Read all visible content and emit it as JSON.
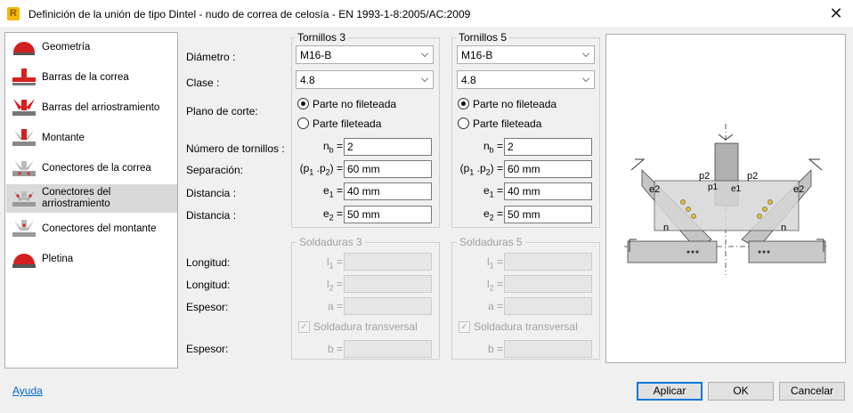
{
  "title": "Definición de la unión de tipo Dintel - nudo de correa de celosía - EN 1993-1-8:2005/AC:2009",
  "sidebar": {
    "items": [
      {
        "label": "Geometría",
        "icon": "geometry-icon"
      },
      {
        "label": "Barras de la correa",
        "icon": "chord-bars-icon"
      },
      {
        "label": "Barras del arriostramiento",
        "icon": "bracing-bars-icon"
      },
      {
        "label": "Montante",
        "icon": "post-icon"
      },
      {
        "label": "Conectores de la correa",
        "icon": "chord-connectors-icon"
      },
      {
        "label": "Conectores del arriostramiento",
        "icon": "bracing-connectors-icon"
      },
      {
        "label": "Conectores del montante",
        "icon": "post-connectors-icon"
      },
      {
        "label": "Pletina",
        "icon": "plate-icon"
      }
    ],
    "selected_index": 5
  },
  "labels": {
    "diametro": "Diámetro :",
    "clase": "Clase :",
    "plano": "Plano de corte:",
    "numero": "Número de tornillos :",
    "separacion": "Separación:",
    "distancia1": "Distancia :",
    "distancia2": "Distancia :",
    "longitud1": "Longitud:",
    "longitud2": "Longitud:",
    "espesor1": "Espesor:",
    "espesor2": "Espesor:"
  },
  "bolts3": {
    "title": "Tornillos 3",
    "diameter": "M16-B",
    "class": "4.8",
    "plane_option1": "Parte no fileteada",
    "plane_option2": "Parte fileteada",
    "plane_selected": "Parte no fileteada",
    "nb": "2",
    "p": "60 mm",
    "e1": "40 mm",
    "e2": "50 mm"
  },
  "bolts5": {
    "title": "Tornillos 5",
    "diameter": "M16-B",
    "class": "4.8",
    "plane_option1": "Parte no fileteada",
    "plane_option2": "Parte fileteada",
    "plane_selected": "Parte no fileteada",
    "nb": "2",
    "p": "60 mm",
    "e1": "40 mm",
    "e2": "50 mm"
  },
  "welds3": {
    "title": "Soldaduras 3",
    "l1": "",
    "l2": "",
    "a": "",
    "b": "",
    "transverse_label": "Soldadura transversal",
    "transverse_checked": true
  },
  "welds5": {
    "title": "Soldaduras 5",
    "l1": "",
    "l2": "",
    "a": "",
    "b": "",
    "transverse_label": "Soldadura transversal",
    "transverse_checked": true
  },
  "symbols": {
    "nb_base": "n",
    "nb_sub": "b",
    "p_text": "(p",
    "p_sub1": "1",
    "p_mid": " .p",
    "p_sub2": "2",
    "p_end": ") =",
    "e1_base": "e",
    "e1_sub": "1",
    "e2_base": "e",
    "e2_sub": "2",
    "l1_base": "l",
    "l1_sub": "1",
    "l2_base": "l",
    "l2_sub": "2",
    "a": "a =",
    "b": "b =",
    "eq": "="
  },
  "drawing_labels": {
    "p2": "p2",
    "p1": "p1",
    "e2": "e2",
    "e1": "e1",
    "n": "n"
  },
  "buttons": {
    "help": "Ayuda",
    "apply": "Aplicar",
    "ok": "OK",
    "cancel": "Cancelar"
  },
  "colors": {
    "accent": "#0078d7",
    "icon_red": "#d42020",
    "steel": "#b8b8b8"
  }
}
